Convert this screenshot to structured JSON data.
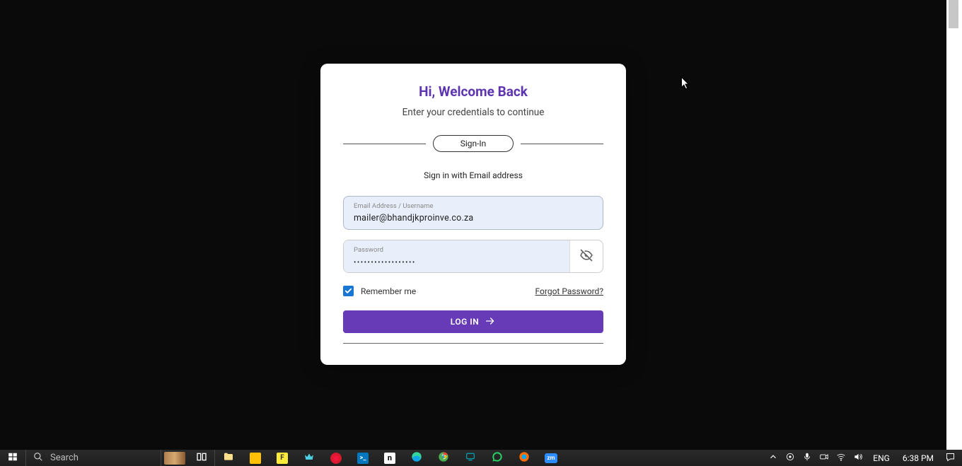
{
  "login": {
    "title": "Hi, Welcome Back",
    "subtitle": "Enter your credentials to continue",
    "pill_label": "Sign-In",
    "method_label": "Sign in with Email address",
    "email_label": "Email Address / Username",
    "email_value": "mailer@bhandjkproinve.co.za",
    "password_label": "Password",
    "password_value": "••••••••••••••••••",
    "remember_label": "Remember me",
    "remember_checked": true,
    "forgot_label": "Forgot Password?",
    "login_button": "LOG IN"
  },
  "colors": {
    "accent": "#673ab7",
    "title": "#5e35b1",
    "checkbox": "#1976d2"
  },
  "taskbar": {
    "search_placeholder": "Search",
    "language": "ENG",
    "time": "6:38 PM"
  }
}
